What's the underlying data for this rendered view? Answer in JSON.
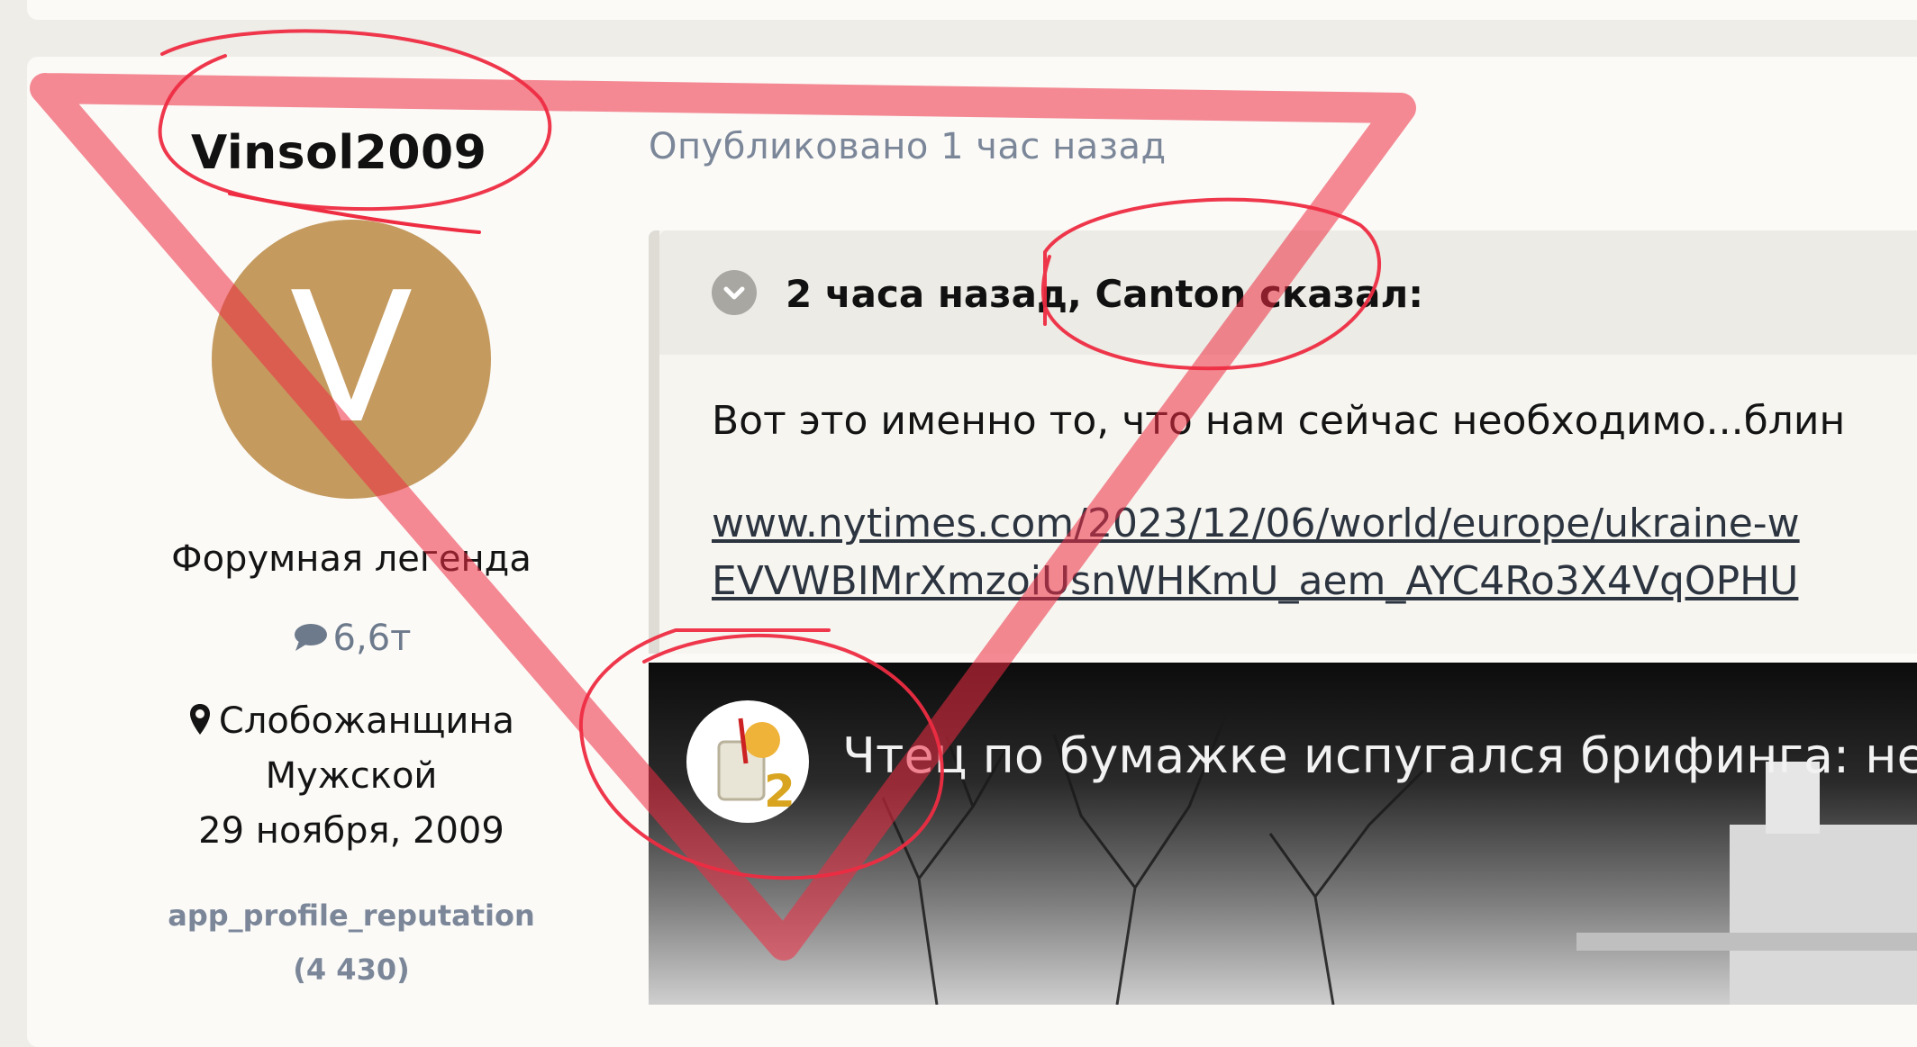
{
  "post": {
    "author": "Vinsol2009",
    "avatar_letter": "V",
    "rank": "Форумная легенда",
    "post_count": "6,6т",
    "location": "Слобожанщина",
    "gender": "Мужской",
    "joined": "29 ноября, 2009",
    "reputation_label": "app_profile_reputation",
    "reputation_value": "(4 430)",
    "published": "Опубликовано 1 час назад"
  },
  "quote": {
    "header": "2 часа назад, Canton сказал:",
    "text": "Вот это именно то, что нам сейчас необходимо...блин",
    "link_line1": "www.nytimes.com/2023/12/06/world/europe/ukraine-w",
    "link_line2": "EVVWBIMrXmzoiUsnWHKmU_aem_AYC4Ro3X4VqOPHU"
  },
  "video": {
    "title": "Чтец по бумажке испугался брифинга: не",
    "channel_icon": "channel-logo-icon"
  },
  "colors": {
    "page_bg": "#eeede8",
    "card_bg": "#fbfaf7",
    "avatar_bg": "#c49a5f",
    "muted_text": "#7b8799",
    "annotation_red": "#e8283c"
  },
  "icons": [
    "chevron-down-icon",
    "chat-bubble-icon",
    "map-pin-icon",
    "channel-logo-icon"
  ]
}
